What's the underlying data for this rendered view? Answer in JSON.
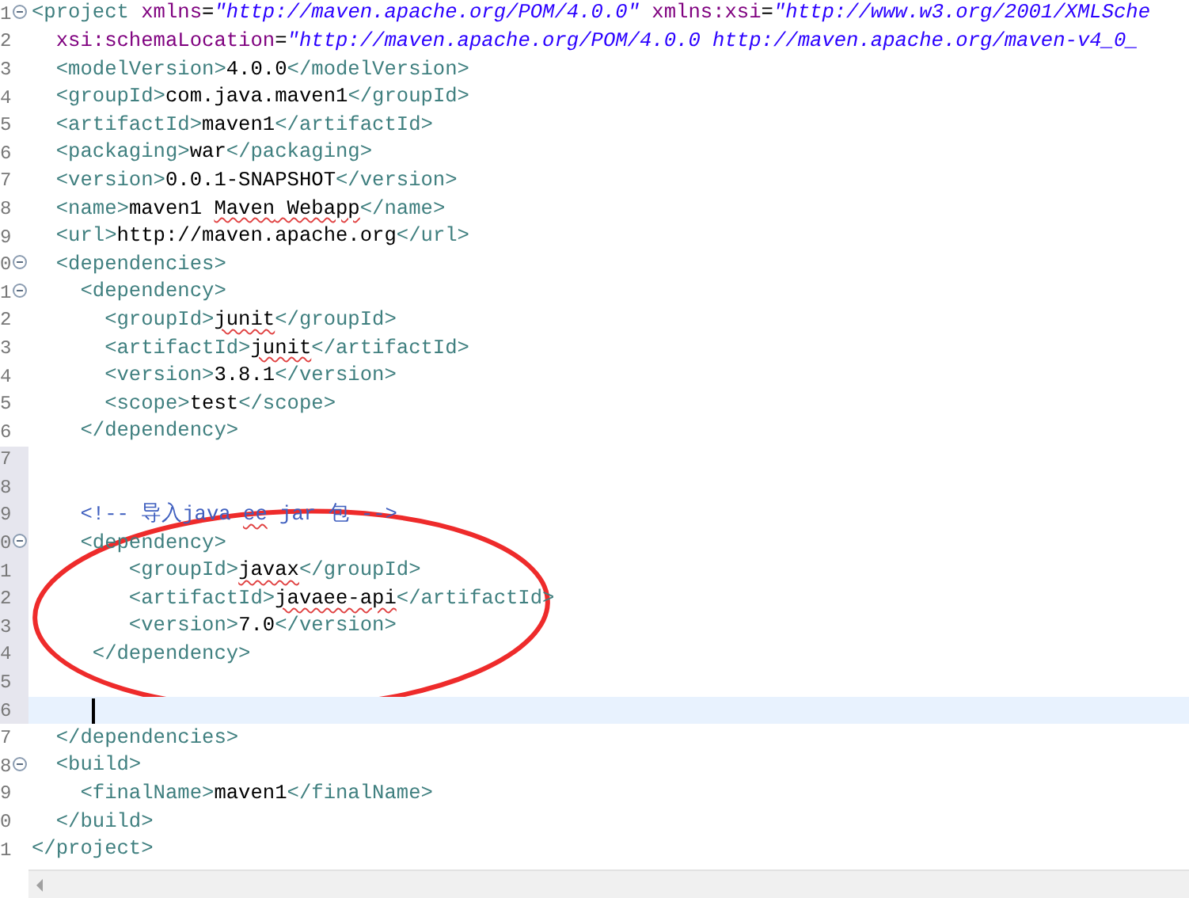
{
  "editor": {
    "lines": [
      {
        "number": "1",
        "fold": true,
        "changed": false,
        "current": false,
        "tokens": [
          {
            "kind": "tag",
            "text": "<project "
          },
          {
            "kind": "attr",
            "text": "xmlns"
          },
          {
            "kind": "plain",
            "text": "="
          },
          {
            "kind": "value",
            "text": "\"http://maven.apache.org/POM/4.0.0\""
          },
          {
            "kind": "attr",
            "text": " xmlns:xsi"
          },
          {
            "kind": "plain",
            "text": "="
          },
          {
            "kind": "value",
            "text": "\"http://www.w3.org/2001/XMLSche"
          }
        ]
      },
      {
        "number": "2",
        "fold": false,
        "changed": false,
        "current": false,
        "tokens": [
          {
            "kind": "attr",
            "text": "  xsi:schemaLocation"
          },
          {
            "kind": "plain",
            "text": "="
          },
          {
            "kind": "value",
            "text": "\"http://maven.apache.org/POM/4.0.0 http://maven.apache.org/maven-v4_0_"
          }
        ]
      },
      {
        "number": "3",
        "fold": false,
        "changed": false,
        "current": false,
        "tokens": [
          {
            "kind": "tag",
            "text": "  <modelVersion>"
          },
          {
            "kind": "text",
            "text": "4.0.0"
          },
          {
            "kind": "tag",
            "text": "</modelVersion>"
          }
        ]
      },
      {
        "number": "4",
        "fold": false,
        "changed": false,
        "current": false,
        "tokens": [
          {
            "kind": "tag",
            "text": "  <groupId>"
          },
          {
            "kind": "text",
            "text": "com.java.maven1"
          },
          {
            "kind": "tag",
            "text": "</groupId>"
          }
        ]
      },
      {
        "number": "5",
        "fold": false,
        "changed": false,
        "current": false,
        "tokens": [
          {
            "kind": "tag",
            "text": "  <artifactId>"
          },
          {
            "kind": "text",
            "text": "maven1"
          },
          {
            "kind": "tag",
            "text": "</artifactId>"
          }
        ]
      },
      {
        "number": "6",
        "fold": false,
        "changed": false,
        "current": false,
        "tokens": [
          {
            "kind": "tag",
            "text": "  <packaging>"
          },
          {
            "kind": "text",
            "text": "war"
          },
          {
            "kind": "tag",
            "text": "</packaging>"
          }
        ]
      },
      {
        "number": "7",
        "fold": false,
        "changed": false,
        "current": false,
        "tokens": [
          {
            "kind": "tag",
            "text": "  <version>"
          },
          {
            "kind": "text",
            "text": "0.0.1-SNAPSHOT"
          },
          {
            "kind": "tag",
            "text": "</version>"
          }
        ]
      },
      {
        "number": "8",
        "fold": false,
        "changed": false,
        "current": false,
        "tokens": [
          {
            "kind": "tag",
            "text": "  <name>"
          },
          {
            "kind": "text",
            "text": "maven1 "
          },
          {
            "kind": "text",
            "text": "Maven",
            "misspelled": true
          },
          {
            "kind": "text",
            "text": " Webapp",
            "misspelled": true
          },
          {
            "kind": "tag",
            "text": "</name>"
          }
        ]
      },
      {
        "number": "9",
        "fold": false,
        "changed": false,
        "current": false,
        "tokens": [
          {
            "kind": "tag",
            "text": "  <url>"
          },
          {
            "kind": "text",
            "text": "http://maven.apache.org"
          },
          {
            "kind": "tag",
            "text": "</url>"
          }
        ]
      },
      {
        "number": "0",
        "fold": true,
        "changed": false,
        "current": false,
        "tokens": [
          {
            "kind": "tag",
            "text": "  <dependencies>"
          }
        ]
      },
      {
        "number": "1",
        "fold": true,
        "changed": false,
        "current": false,
        "tokens": [
          {
            "kind": "tag",
            "text": "    <dependency>"
          }
        ]
      },
      {
        "number": "2",
        "fold": false,
        "changed": false,
        "current": false,
        "tokens": [
          {
            "kind": "tag",
            "text": "      <groupId>"
          },
          {
            "kind": "text",
            "text": "junit",
            "misspelled": true
          },
          {
            "kind": "tag",
            "text": "</groupId>"
          }
        ]
      },
      {
        "number": "3",
        "fold": false,
        "changed": false,
        "current": false,
        "tokens": [
          {
            "kind": "tag",
            "text": "      <artifactId>"
          },
          {
            "kind": "text",
            "text": "junit",
            "misspelled": true
          },
          {
            "kind": "tag",
            "text": "</artifactId>"
          }
        ]
      },
      {
        "number": "4",
        "fold": false,
        "changed": false,
        "current": false,
        "tokens": [
          {
            "kind": "tag",
            "text": "      <version>"
          },
          {
            "kind": "text",
            "text": "3.8.1"
          },
          {
            "kind": "tag",
            "text": "</version>"
          }
        ]
      },
      {
        "number": "5",
        "fold": false,
        "changed": false,
        "current": false,
        "tokens": [
          {
            "kind": "tag",
            "text": "      <scope>"
          },
          {
            "kind": "text",
            "text": "test"
          },
          {
            "kind": "tag",
            "text": "</scope>"
          }
        ]
      },
      {
        "number": "6",
        "fold": false,
        "changed": false,
        "current": false,
        "tokens": [
          {
            "kind": "tag",
            "text": "    </dependency>"
          }
        ]
      },
      {
        "number": "7",
        "fold": false,
        "changed": true,
        "current": false
      },
      {
        "number": "8",
        "fold": false,
        "changed": true,
        "current": false
      },
      {
        "number": "9",
        "fold": false,
        "changed": true,
        "current": false,
        "tokens": [
          {
            "kind": "comment",
            "text": "    <!-- 导入java "
          },
          {
            "kind": "comment",
            "text": "ee",
            "misspelled": true
          },
          {
            "kind": "comment",
            "text": " jar 包 -->"
          }
        ]
      },
      {
        "number": "0",
        "fold": true,
        "changed": true,
        "current": false,
        "tokens": [
          {
            "kind": "tag",
            "text": "    <dependency>"
          }
        ]
      },
      {
        "number": "1",
        "fold": false,
        "changed": true,
        "current": false,
        "tokens": [
          {
            "kind": "tag",
            "text": "        <groupId>"
          },
          {
            "kind": "text",
            "text": "javax",
            "misspelled": true
          },
          {
            "kind": "tag",
            "text": "</groupId>"
          }
        ]
      },
      {
        "number": "2",
        "fold": false,
        "changed": true,
        "current": false,
        "tokens": [
          {
            "kind": "tag",
            "text": "        <artifactId>"
          },
          {
            "kind": "text",
            "text": "javaee-api",
            "misspelled": true
          },
          {
            "kind": "tag",
            "text": "</artifactId>"
          }
        ]
      },
      {
        "number": "3",
        "fold": false,
        "changed": true,
        "current": false,
        "tokens": [
          {
            "kind": "tag",
            "text": "        <version>"
          },
          {
            "kind": "text",
            "text": "7.0"
          },
          {
            "kind": "tag",
            "text": "</version>"
          }
        ]
      },
      {
        "number": "4",
        "fold": false,
        "changed": true,
        "current": false,
        "tokens": [
          {
            "kind": "tag",
            "text": "     </dependency>"
          }
        ]
      },
      {
        "number": "5",
        "fold": false,
        "changed": true,
        "current": false
      },
      {
        "number": "6",
        "fold": false,
        "changed": true,
        "current": true
      },
      {
        "number": "7",
        "fold": false,
        "changed": false,
        "current": false,
        "tokens": [
          {
            "kind": "tag",
            "text": "  </dependencies>"
          }
        ]
      },
      {
        "number": "8",
        "fold": true,
        "changed": false,
        "current": false,
        "tokens": [
          {
            "kind": "tag",
            "text": "  <build>"
          }
        ]
      },
      {
        "number": "9",
        "fold": false,
        "changed": false,
        "current": false,
        "tokens": [
          {
            "kind": "tag",
            "text": "    <finalName>"
          },
          {
            "kind": "text",
            "text": "maven1"
          },
          {
            "kind": "tag",
            "text": "</finalName>"
          }
        ]
      },
      {
        "number": "0",
        "fold": false,
        "changed": false,
        "current": false,
        "tokens": [
          {
            "kind": "tag",
            "text": "  </build>"
          }
        ]
      },
      {
        "number": "1",
        "fold": false,
        "changed": false,
        "current": false,
        "tokens": [
          {
            "kind": "tag",
            "text": "</project>"
          }
        ]
      }
    ]
  }
}
